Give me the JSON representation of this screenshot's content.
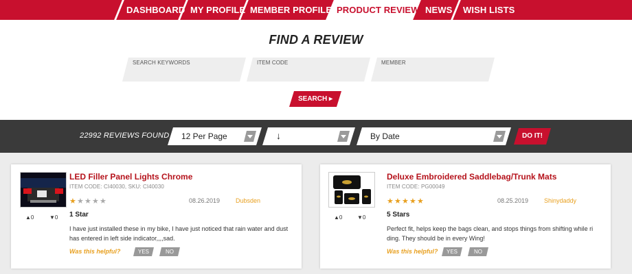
{
  "colors": {
    "brand_red": "#c8102e",
    "title_red": "#b5121b",
    "accent_orange": "#e8a020",
    "bar_dark": "#3a3a3a"
  },
  "nav": [
    {
      "label": "DASHBOARD"
    },
    {
      "label": "MY PROFILE"
    },
    {
      "label": "MEMBER PROFILES"
    },
    {
      "label": "PRODUCT REVIEWS",
      "active": true
    },
    {
      "label": "NEWS"
    },
    {
      "label": "WISH LISTS"
    }
  ],
  "finder": {
    "title": "FIND A REVIEW",
    "fields": [
      {
        "label": "SEARCH KEYWORDS",
        "value": ""
      },
      {
        "label": "ITEM CODE",
        "value": ""
      },
      {
        "label": "MEMBER",
        "value": ""
      }
    ],
    "search_label": "SEARCH ▸"
  },
  "filters": {
    "found_text": "22992 REVIEWS FOUND",
    "per_page": "12 Per Page",
    "order": "↓",
    "sort": "By Date",
    "doit_label": "DO IT!",
    "dropdown_icon": "chevron-down-icon"
  },
  "reviews": [
    {
      "title": "LED Filler Panel Lights Chrome",
      "codes": "ITEM CODE: CI40030,  SKU: CI40030",
      "stars": 1,
      "date": "08.26.2019",
      "reviewer": "Dubsden",
      "up": "▲0",
      "down": "▼0",
      "rating_label": "1 Star",
      "text": "I have just installed these in my bike, I have just noticed that rain water and dust has entered in left side indicator,,,,sad.",
      "helpful_label": "Was this helpful?",
      "yes_label": "YES",
      "no_label": "NO"
    },
    {
      "title": "Deluxe Embroidered Saddlebag/Trunk Mats",
      "codes": "ITEM CODE: PG00049",
      "stars": 5,
      "date": "08.25.2019",
      "reviewer": "Shinydaddy",
      "up": "▲0",
      "down": "▼0",
      "rating_label": "5 Stars",
      "text": "Perfect fit, helps keep the bags clean, and stops things from shifting while ri ding. They should be in every Wing!",
      "helpful_label": "Was this helpful?",
      "yes_label": "YES",
      "no_label": "NO"
    }
  ]
}
